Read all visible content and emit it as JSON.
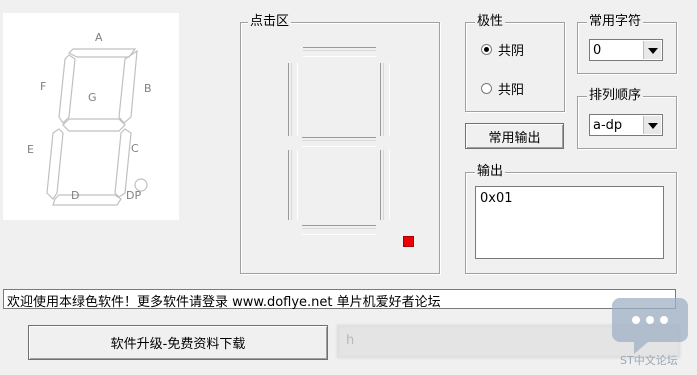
{
  "segment_preview": {
    "labels": {
      "a": "A",
      "b": "B",
      "c": "C",
      "d": "D",
      "e": "E",
      "f": "F",
      "g": "G",
      "dp": "DP"
    }
  },
  "click_area": {
    "title": "点击区"
  },
  "polarity": {
    "title": "极性",
    "options": [
      {
        "label": "共阴",
        "checked": true
      },
      {
        "label": "共阳",
        "checked": false
      }
    ]
  },
  "common_char": {
    "title": "常用字符",
    "selected": "0"
  },
  "order": {
    "title": "排列顺序",
    "selected": "a-dp"
  },
  "common_output_button": "常用输出",
  "output": {
    "title": "输出",
    "value": "0x01"
  },
  "status_text": "欢迎使用本绿色软件！更多软件请登录 www.doflye.net 单片机爱好者论坛",
  "upgrade_button": "软件升级-免费资料下载",
  "blurred_button_text": "h",
  "watermark": {
    "text": "ST中文论坛"
  },
  "colors": {
    "dp_active": "#ee0000",
    "window_bg": "#f0f0f0"
  }
}
